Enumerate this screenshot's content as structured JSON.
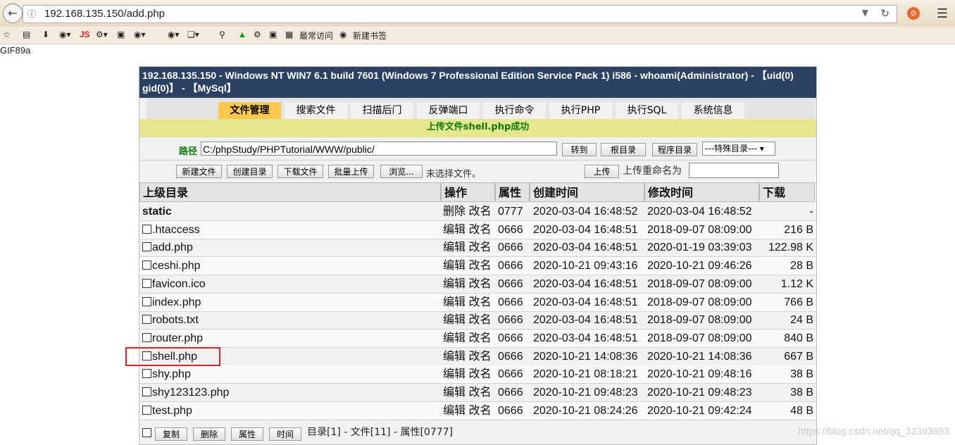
{
  "browser": {
    "url": "192.168.135.150/add.php",
    "bookmarks": {
      "js_label": "JS",
      "frequent": "最常访问",
      "new_bookmark": "新建书签"
    }
  },
  "page_top_text": "GIF89a",
  "panel": {
    "title": "192.168.135.150 - Windows NT WIN7 6.1 build 7601 (Windows 7 Professional Edition Service Pack 1) i586 - whoami(Administrator) - 【uid(0) gid(0)】 - 【MySql】",
    "tabs": [
      "文件管理",
      "搜索文件",
      "扫描后门",
      "反弹端口",
      "执行命令",
      "执行PHP",
      "执行SQL",
      "系统信息"
    ],
    "message": "上传文件shell.php成功",
    "path_label": "路径",
    "path_value": "C:/phpStudy/PHPTutorial/WWW/public/",
    "goto_button": "转到",
    "root_button": "根目录",
    "program_dir_button": "程序目录",
    "special_dir_select": "---特殊目录---",
    "actions": {
      "new_file": "新建文件",
      "create_dir": "创建目录",
      "download_file": "下载文件",
      "batch_upload": "批量上传",
      "browse": "浏览...",
      "no_file": "未选择文件。",
      "upload": "上传",
      "rename_label": "上传重命名为"
    },
    "table": {
      "headers": [
        "上级目录",
        "操作",
        "属性",
        "创建时间",
        "修改时间",
        "下载"
      ],
      "dir_row": {
        "name": "static",
        "op": "删除 改名",
        "attr": "0777",
        "ctime": "2020-03-04 16:48:52",
        "mtime": "2020-03-04 16:48:52",
        "size": "-"
      },
      "files": [
        {
          "name": ".htaccess",
          "op": "编辑 改名",
          "attr": "0666",
          "ctime": "2020-03-04 16:48:51",
          "mtime": "2018-09-07 08:09:00",
          "size": "216 B"
        },
        {
          "name": "add.php",
          "op": "编辑 改名",
          "attr": "0666",
          "ctime": "2020-03-04 16:48:51",
          "mtime": "2020-01-19 03:39:03",
          "size": "122.98 K"
        },
        {
          "name": "ceshi.php",
          "op": "编辑 改名",
          "attr": "0666",
          "ctime": "2020-10-21 09:43:16",
          "mtime": "2020-10-21 09:46:26",
          "size": "28 B"
        },
        {
          "name": "favicon.ico",
          "op": "编辑 改名",
          "attr": "0666",
          "ctime": "2020-03-04 16:48:51",
          "mtime": "2018-09-07 08:09:00",
          "size": "1.12 K"
        },
        {
          "name": "index.php",
          "op": "编辑 改名",
          "attr": "0666",
          "ctime": "2020-03-04 16:48:51",
          "mtime": "2018-09-07 08:09:00",
          "size": "766 B"
        },
        {
          "name": "robots.txt",
          "op": "编辑 改名",
          "attr": "0666",
          "ctime": "2020-03-04 16:48:51",
          "mtime": "2018-09-07 08:09:00",
          "size": "24 B"
        },
        {
          "name": "router.php",
          "op": "编辑 改名",
          "attr": "0666",
          "ctime": "2020-03-04 16:48:51",
          "mtime": "2018-09-07 08:09:00",
          "size": "840 B"
        },
        {
          "name": "shell.php",
          "op": "编辑 改名",
          "attr": "0666",
          "ctime": "2020-10-21 14:08:36",
          "mtime": "2020-10-21 14:08:36",
          "size": "667 B"
        },
        {
          "name": "shy.php",
          "op": "编辑 改名",
          "attr": "0666",
          "ctime": "2020-10-21 08:18:21",
          "mtime": "2020-10-21 09:48:16",
          "size": "38 B"
        },
        {
          "name": "shy123123.php",
          "op": "编辑 改名",
          "attr": "0666",
          "ctime": "2020-10-21 09:48:23",
          "mtime": "2020-10-21 09:48:23",
          "size": "38 B"
        },
        {
          "name": "test.php",
          "op": "编辑 改名",
          "attr": "0666",
          "ctime": "2020-10-21 08:24:26",
          "mtime": "2020-10-21 09:42:24",
          "size": "48 B"
        }
      ]
    },
    "footer": {
      "copy": "复制",
      "delete": "删除",
      "attr": "属性",
      "time": "时间",
      "summary": "目录[1] - 文件[11] - 属性[0777]"
    }
  },
  "watermark": "https://blog.csdn.net/qq_32393893"
}
